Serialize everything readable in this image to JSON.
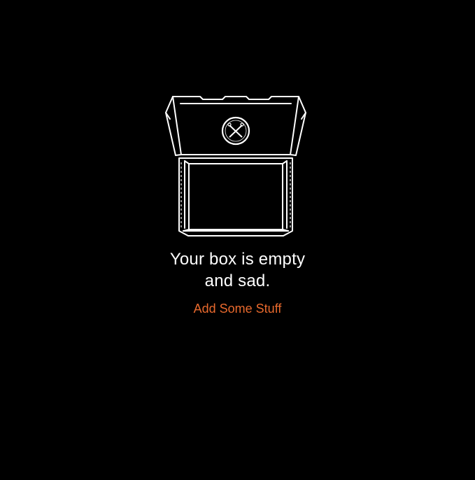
{
  "empty_state": {
    "message_line1": "Your box is empty",
    "message_line2": "and sad.",
    "cta_label": "Add Some Stuff",
    "illustration_icon": "open-box-icon",
    "logo_icon": "crossed-tools-emblem-icon"
  },
  "colors": {
    "background": "#000000",
    "text": "#ffffff",
    "accent": "#e8692d",
    "illustration_stroke": "#ffffff"
  }
}
